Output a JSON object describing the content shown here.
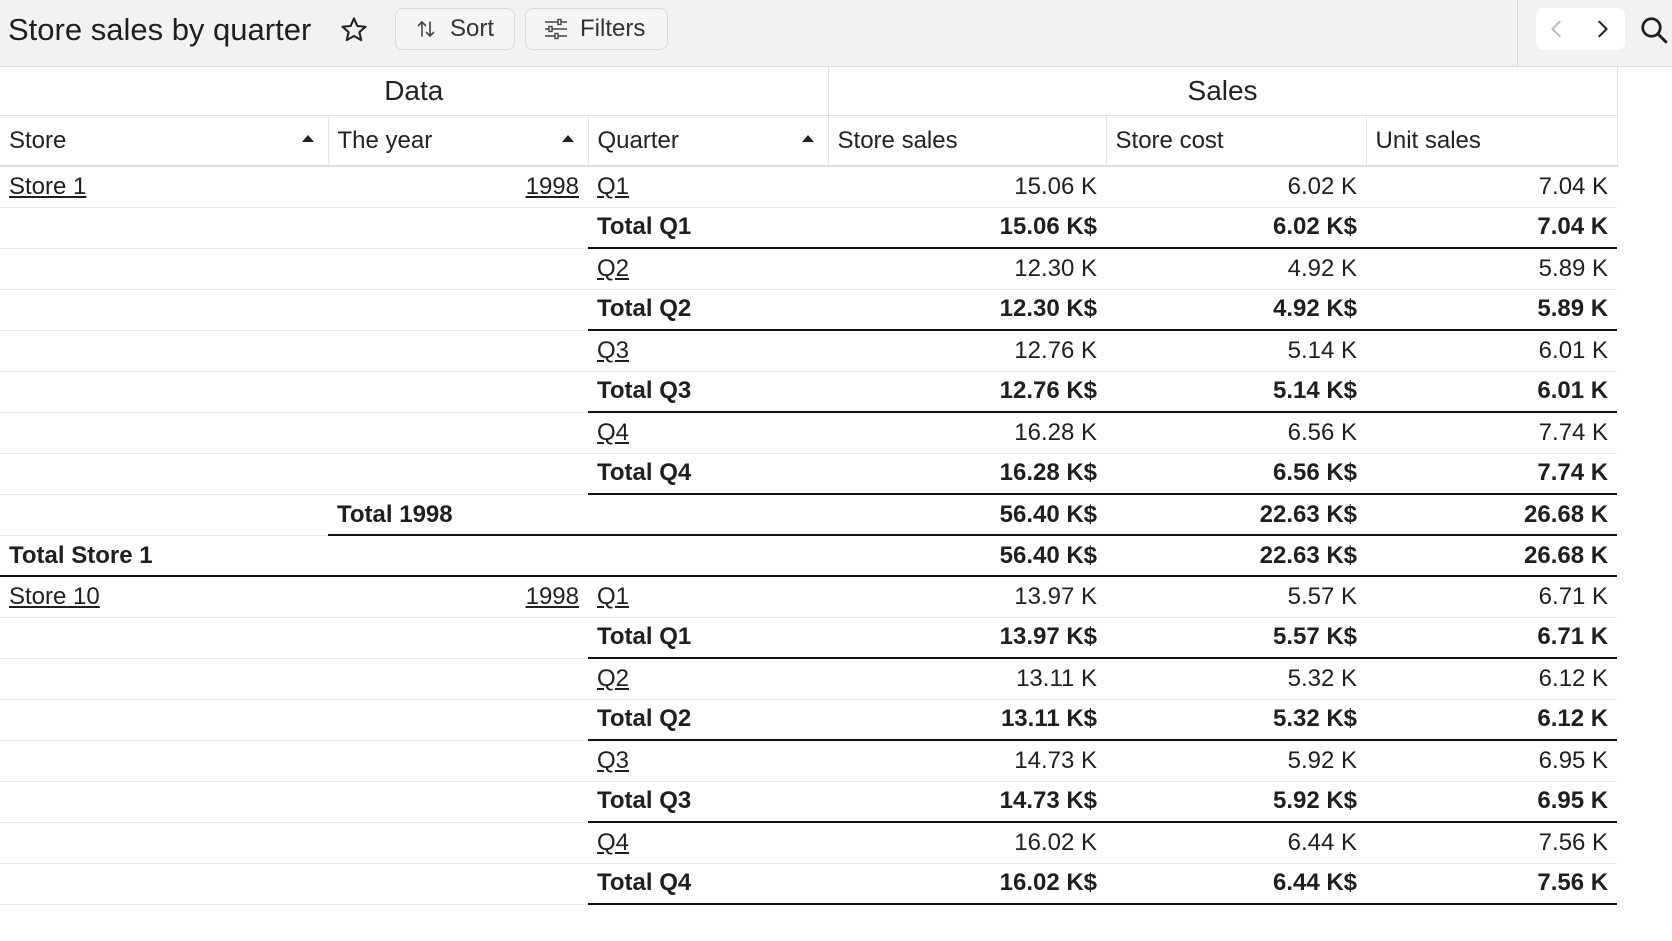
{
  "header": {
    "title": "Store sales by quarter",
    "sort_label": "Sort",
    "filters_label": "Filters"
  },
  "icons": {
    "favorite": "star-outline-icon",
    "sort": "sort-arrows-icon",
    "filters": "sliders-icon",
    "prev": "chevron-left-icon",
    "next": "chevron-right-icon",
    "search": "search-icon",
    "sort_asc": "triangle-up-icon"
  },
  "table": {
    "group_headers": [
      "Data",
      "Sales"
    ],
    "columns": [
      "Store",
      "The year",
      "Quarter",
      "Store sales",
      "Store cost",
      "Unit sales"
    ],
    "rows": [
      {
        "kind": "data",
        "store": "Store 1",
        "year": "1998",
        "quarter": "Q1",
        "sales": "15.06 K",
        "cost": "6.02 K",
        "units": "7.04 K"
      },
      {
        "kind": "qtotal",
        "label": "Total Q1",
        "sales": "15.06 K$",
        "cost": "6.02 K$",
        "units": "7.04 K"
      },
      {
        "kind": "data",
        "store": "",
        "year": "",
        "quarter": "Q2",
        "sales": "12.30 K",
        "cost": "4.92 K",
        "units": "5.89 K"
      },
      {
        "kind": "qtotal",
        "label": "Total Q2",
        "sales": "12.30 K$",
        "cost": "4.92 K$",
        "units": "5.89 K"
      },
      {
        "kind": "data",
        "store": "",
        "year": "",
        "quarter": "Q3",
        "sales": "12.76 K",
        "cost": "5.14 K",
        "units": "6.01 K"
      },
      {
        "kind": "qtotal",
        "label": "Total Q3",
        "sales": "12.76 K$",
        "cost": "5.14 K$",
        "units": "6.01 K"
      },
      {
        "kind": "data",
        "store": "",
        "year": "",
        "quarter": "Q4",
        "sales": "16.28 K",
        "cost": "6.56 K",
        "units": "7.74 K"
      },
      {
        "kind": "qtotal",
        "label": "Total Q4",
        "sales": "16.28 K$",
        "cost": "6.56 K$",
        "units": "7.74 K"
      },
      {
        "kind": "ytotal",
        "label": "Total 1998",
        "sales": "56.40 K$",
        "cost": "22.63 K$",
        "units": "26.68 K"
      },
      {
        "kind": "stotal",
        "label": "Total Store 1",
        "sales": "56.40 K$",
        "cost": "22.63 K$",
        "units": "26.68 K"
      },
      {
        "kind": "data",
        "store": "Store 10",
        "year": "1998",
        "quarter": "Q1",
        "sales": "13.97 K",
        "cost": "5.57 K",
        "units": "6.71 K"
      },
      {
        "kind": "qtotal",
        "label": "Total Q1",
        "sales": "13.97 K$",
        "cost": "5.57 K$",
        "units": "6.71 K"
      },
      {
        "kind": "data",
        "store": "",
        "year": "",
        "quarter": "Q2",
        "sales": "13.11 K",
        "cost": "5.32 K",
        "units": "6.12 K"
      },
      {
        "kind": "qtotal",
        "label": "Total Q2",
        "sales": "13.11 K$",
        "cost": "5.32 K$",
        "units": "6.12 K"
      },
      {
        "kind": "data",
        "store": "",
        "year": "",
        "quarter": "Q3",
        "sales": "14.73 K",
        "cost": "5.92 K",
        "units": "6.95 K"
      },
      {
        "kind": "qtotal",
        "label": "Total Q3",
        "sales": "14.73 K$",
        "cost": "5.92 K$",
        "units": "6.95 K"
      },
      {
        "kind": "data",
        "store": "",
        "year": "",
        "quarter": "Q4",
        "sales": "16.02 K",
        "cost": "6.44 K",
        "units": "7.56 K"
      },
      {
        "kind": "qtotal",
        "label": "Total Q4",
        "sales": "16.02 K$",
        "cost": "6.44 K$",
        "units": "7.56 K"
      }
    ]
  }
}
